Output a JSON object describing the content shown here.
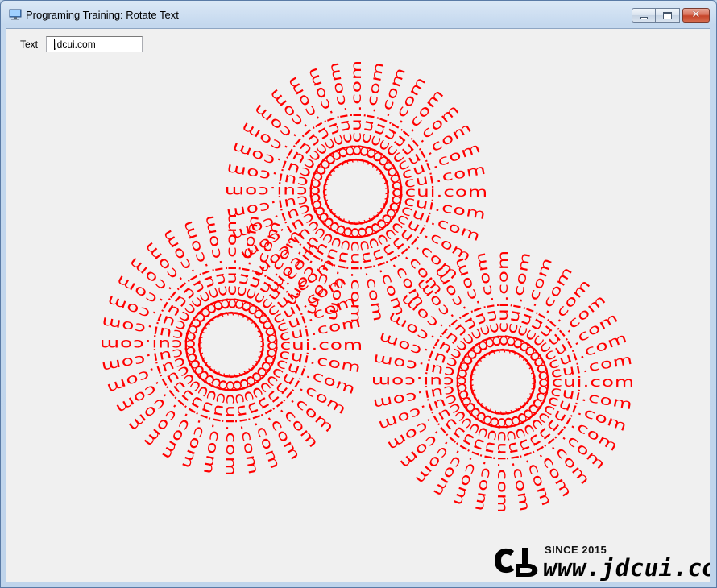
{
  "window": {
    "title": "Programing Training: Rotate Text"
  },
  "form": {
    "text_label": "Text",
    "text_value": "jdcui.com"
  },
  "canvas": {
    "text_color": "#ff0000",
    "rotated_text": "jdcui.com",
    "copies_per_circle": 36,
    "circles": 3
  },
  "watermark": {
    "since": "SINCE 2015",
    "url": "www.jdcui.com",
    "logo_text": "CJD"
  },
  "colors": {
    "client_bg": "#f0f0f0",
    "rotated_text": "#ff0000",
    "close_button": "#c6452a"
  }
}
